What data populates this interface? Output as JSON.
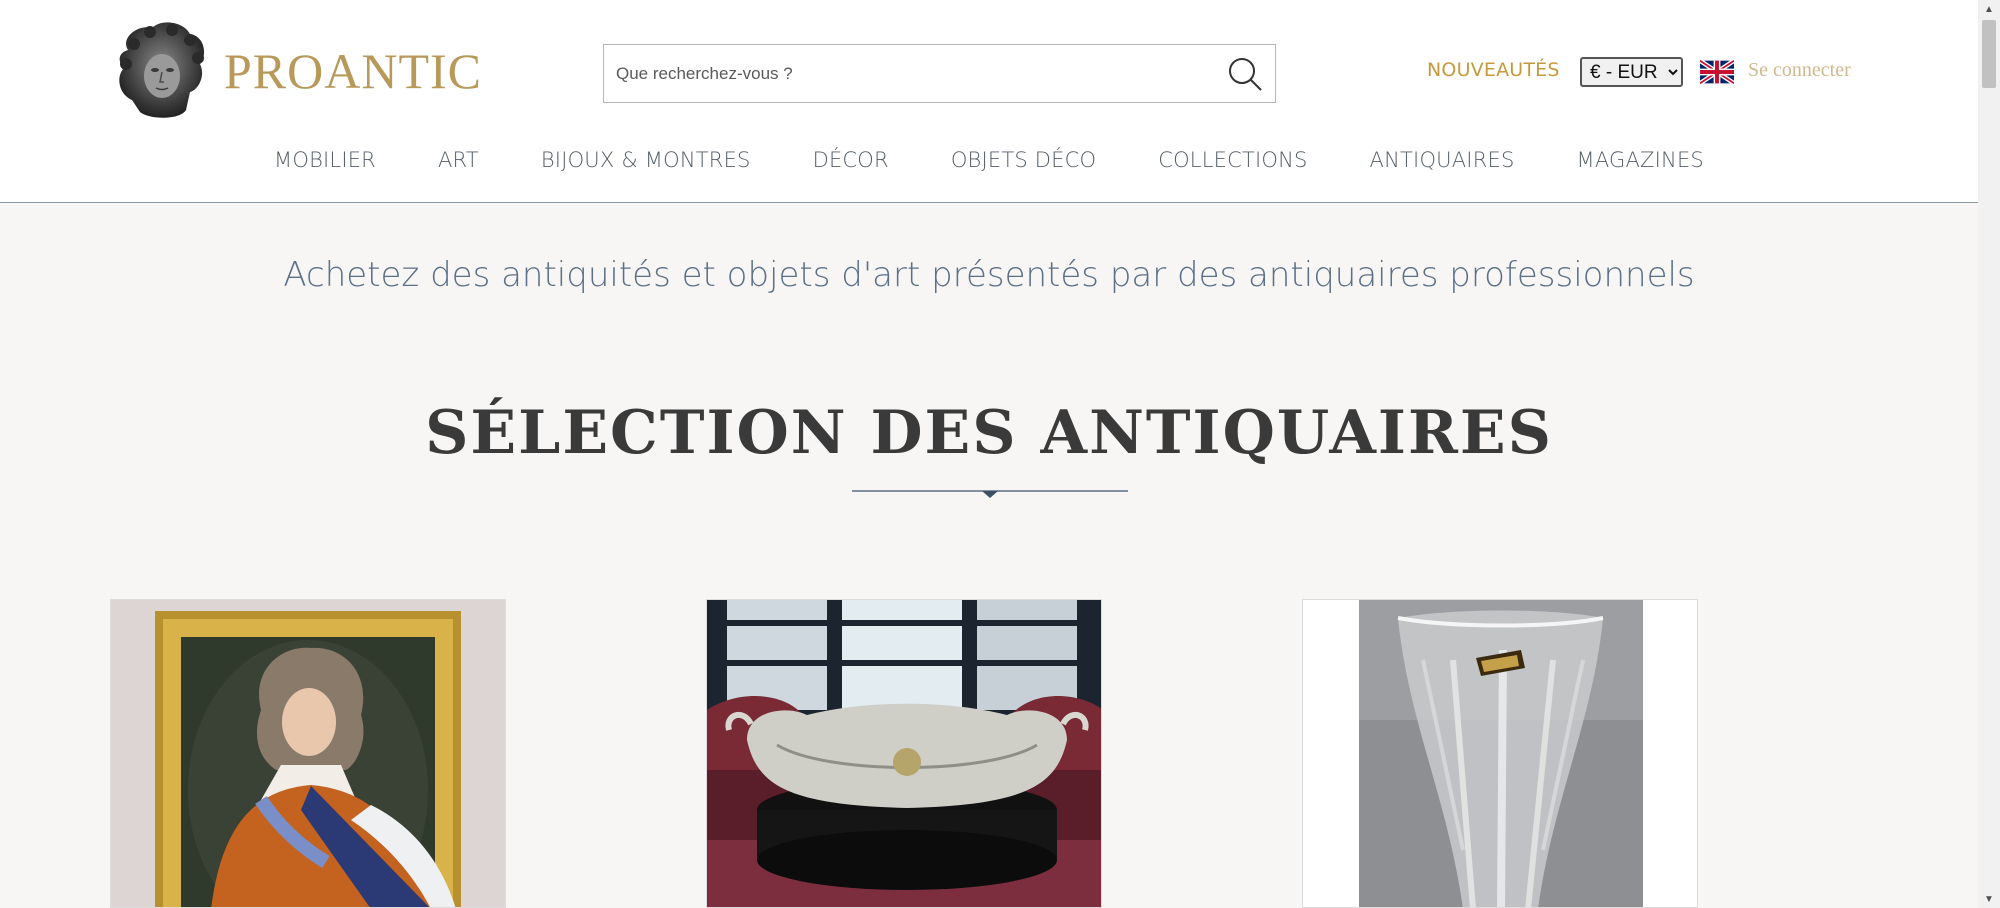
{
  "header": {
    "brand": "PROANTIC",
    "search_placeholder": "Que recherchez-vous ?",
    "nouveautes": "NOUVEAUTÉS",
    "currency_selected": "€ - EUR",
    "language_icon": "uk-flag-icon",
    "login": "Se connecter"
  },
  "nav": {
    "items": [
      "MOBILIER",
      "ART",
      "BIJOUX & MONTRES",
      "DÉCOR",
      "OBJETS DÉCO",
      "COLLECTIONS",
      "ANTIQUAIRES",
      "MAGAZINES"
    ]
  },
  "main": {
    "tagline": "Achetez des antiquités et objets d'art présentés par des antiquaires professionnels",
    "section_title": "SÉLECTION DES ANTIQUAIRES"
  },
  "colors": {
    "brand_gold": "#b8995a",
    "nouveautes_gold": "#c59a3d",
    "nav_text": "#555e68",
    "tagline_blue": "#5b6f87",
    "page_bg": "#f7f6f4"
  }
}
